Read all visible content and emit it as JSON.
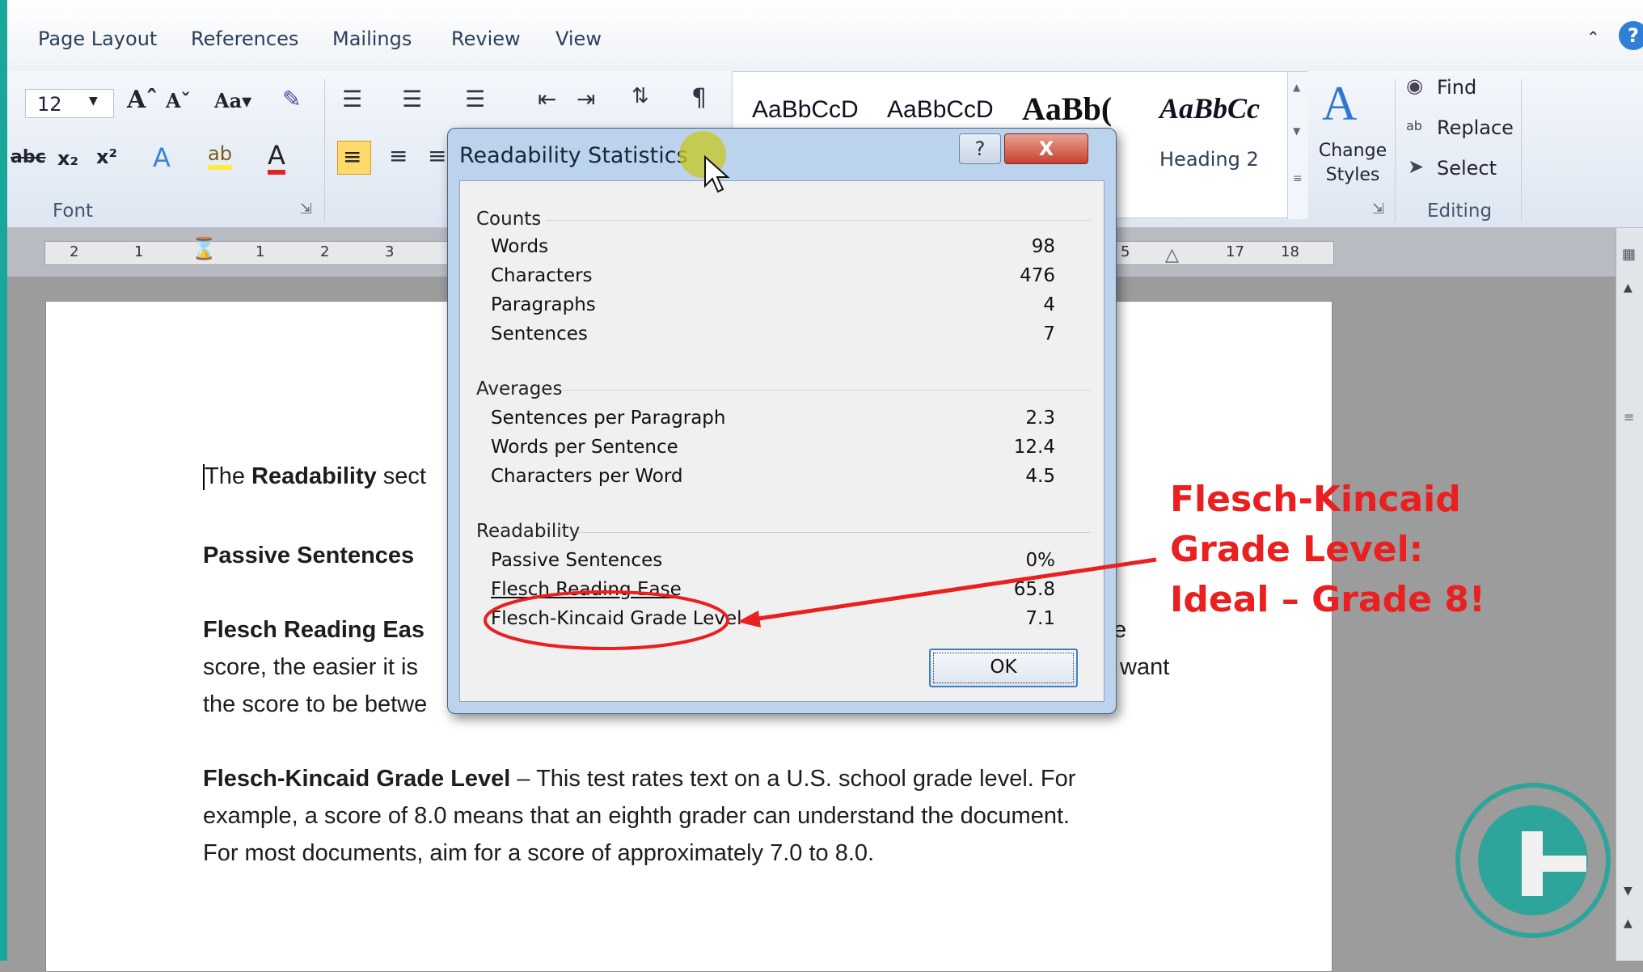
{
  "ribbon": {
    "tabs": [
      "Page Layout",
      "References",
      "Mailings",
      "Review",
      "View"
    ],
    "font_size": "12",
    "format_icons": [
      "grow-font-icon",
      "shrink-font-icon",
      "change-case-icon",
      "clear-format-icon"
    ],
    "groups": {
      "font": "Font",
      "editing": "Editing"
    },
    "styles": [
      {
        "preview": "AaBbCcD",
        "caption": ""
      },
      {
        "preview": "AaBbCcD",
        "caption": ""
      },
      {
        "preview": "AaBb(",
        "caption": ""
      },
      {
        "preview": "AaBbCc",
        "caption": "Heading 2"
      }
    ],
    "change_styles": "Change Styles",
    "editing": {
      "find": "Find",
      "replace": "Replace",
      "select": "Select"
    }
  },
  "ruler": {
    "labels": [
      "2",
      "1",
      "1",
      "2",
      "3",
      "5",
      "17",
      "18"
    ]
  },
  "document": {
    "p1_lead": "The ",
    "p1_bold": "Readability",
    "p1_rest": " sect",
    "p2_bold": "Passive Sentences",
    "p3_bold": "Flesch Reading Eas",
    "p3_tail": "e",
    "p3_l2": "score, the easier it is",
    "p3_l2_tail": "want",
    "p3_l3": "the score to be betwe",
    "p4_bold": "Flesch-Kincaid Grade Level",
    "p4_l1": " – This test rates text on a U.S. school grade level. For",
    "p4_l2": "example, a score of 8.0 means that an eighth grader can understand the document.",
    "p4_l3": "For most documents, aim for a score of approximately 7.0 to 8.0."
  },
  "dialog": {
    "title": "Readability Statistics",
    "help_label": "?",
    "close_label": "X",
    "sections": {
      "counts": "Counts",
      "averages": "Averages",
      "readability": "Readability"
    },
    "counts": [
      {
        "label": "Words",
        "value": "98"
      },
      {
        "label": "Characters",
        "value": "476"
      },
      {
        "label": "Paragraphs",
        "value": "4"
      },
      {
        "label": "Sentences",
        "value": "7"
      }
    ],
    "averages": [
      {
        "label": "Sentences per Paragraph",
        "value": "2.3"
      },
      {
        "label": "Words per Sentence",
        "value": "12.4"
      },
      {
        "label": "Characters per Word",
        "value": "4.5"
      }
    ],
    "readability": [
      {
        "label": "Passive Sentences",
        "value": "0%"
      },
      {
        "label": "Flesch Reading Ease",
        "value": "65.8"
      },
      {
        "label": "Flesch-Kincaid Grade Level",
        "value": "7.1"
      }
    ],
    "ok_label": "OK"
  },
  "annotation": {
    "line1": "Flesch-Kincaid",
    "line2": "Grade Level:",
    "line3": "Ideal – Grade 8!",
    "color": "#ea1f1f"
  }
}
